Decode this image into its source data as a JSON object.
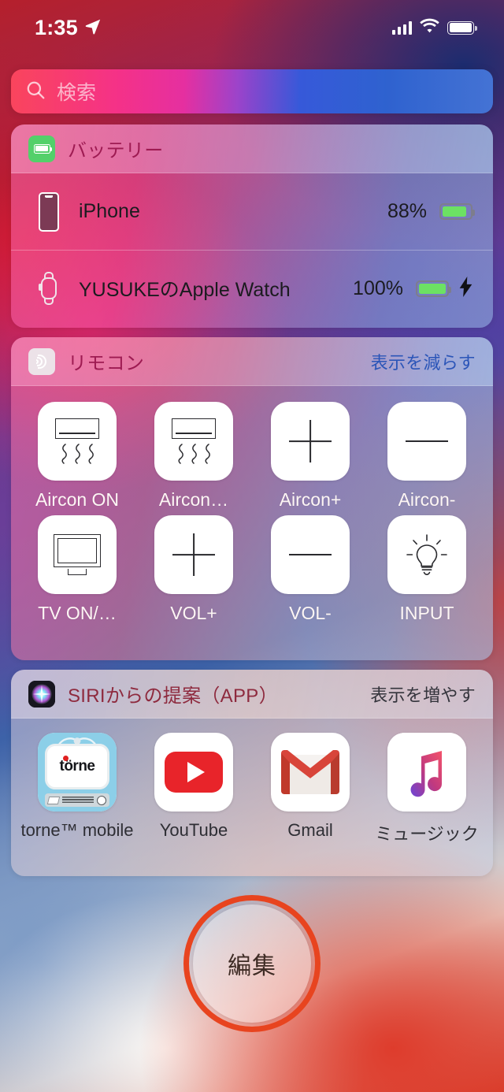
{
  "status_bar": {
    "time": "1:35",
    "location_icon": "location-arrow-icon",
    "signal_icon": "cellular-signal-icon",
    "wifi_icon": "wifi-icon",
    "battery_icon": "battery-full-icon"
  },
  "search": {
    "placeholder": "検索",
    "icon": "search-icon"
  },
  "battery_widget": {
    "icon": "battery-widget-icon",
    "title": "バッテリー",
    "devices": [
      {
        "icon": "iphone-icon",
        "name": "iPhone",
        "percent": "88%",
        "level": 88,
        "charging": false,
        "bolt": ""
      },
      {
        "icon": "apple-watch-icon",
        "name": "YUSUKEのApple Watch",
        "percent": "100%",
        "level": 100,
        "charging": true,
        "bolt": "⚡"
      }
    ]
  },
  "remote_widget": {
    "icon": "remote-signal-icon",
    "title": "リモコン",
    "action": "表示を減らす",
    "buttons": [
      {
        "label": "Aircon ON",
        "icon": "aircon-icon"
      },
      {
        "label": "Aircon…",
        "icon": "aircon-icon"
      },
      {
        "label": "Aircon+",
        "icon": "plus-icon"
      },
      {
        "label": "Aircon-",
        "icon": "minus-icon"
      },
      {
        "label": "TV ON/…",
        "icon": "television-icon"
      },
      {
        "label": "VOL+",
        "icon": "plus-icon"
      },
      {
        "label": "VOL-",
        "icon": "minus-icon"
      },
      {
        "label": "INPUT",
        "icon": "lightbulb-icon"
      }
    ]
  },
  "siri_widget": {
    "icon": "siri-icon",
    "title": "SIRIからの提案（APP）",
    "action": "表示を増やす",
    "apps": [
      {
        "label": "torne™ mobile",
        "icon": "torne-app-icon"
      },
      {
        "label": "YouTube",
        "icon": "youtube-app-icon"
      },
      {
        "label": "Gmail",
        "icon": "gmail-app-icon"
      },
      {
        "label": "ミュージック",
        "icon": "apple-music-app-icon"
      }
    ]
  },
  "edit": {
    "label": "編集",
    "highlight_color": "#e8441f"
  },
  "colors": {
    "title_pink": "#9e1b52",
    "action_blue": "#2b55b8",
    "battery_green": "#6ce163",
    "highlight_red": "#e8441f"
  }
}
